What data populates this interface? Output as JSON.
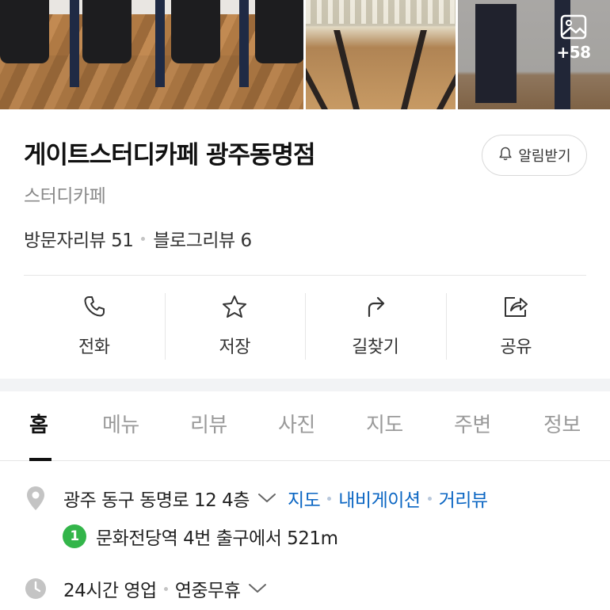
{
  "photos": {
    "more_count": "+58"
  },
  "place": {
    "name": "게이트스터디카페 광주동명점",
    "category": "스터디카페",
    "visitor_reviews": "방문자리뷰 51",
    "blog_reviews": "블로그리뷰 6",
    "alarm_label": "알림받기"
  },
  "actions": {
    "call": "전화",
    "save": "저장",
    "directions": "길찾기",
    "share": "공유"
  },
  "tabs": [
    "홈",
    "메뉴",
    "리뷰",
    "사진",
    "지도",
    "주변",
    "정보"
  ],
  "active_tab": "홈",
  "info": {
    "address": "광주 동구 동명로 12 4층",
    "map_link": "지도",
    "navigation_link": "내비게이션",
    "street_view_link": "거리뷰",
    "subway_line": "1",
    "subway_text": "문화전당역 4번 출구에서 521m",
    "hours": "24시간 영업",
    "holiday": "연중무휴"
  },
  "colors": {
    "link": "#0b66c3",
    "subway_line_1": "#33b54a",
    "tab_active": "#111111",
    "tab_inactive": "#9a9a9a"
  }
}
